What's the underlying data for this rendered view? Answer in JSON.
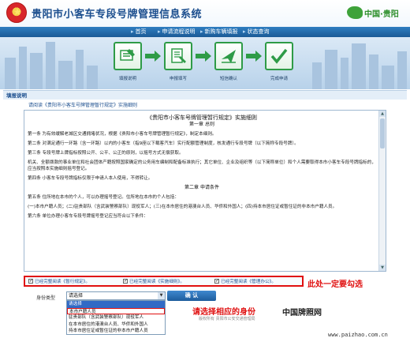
{
  "header": {
    "title": "贵阳市小客车专段号牌管理信息系统",
    "brand_text": "中国·贵阳"
  },
  "nav": {
    "items": [
      "首页",
      "申请流程说明",
      "新购车辆填报",
      "状态查询"
    ]
  },
  "steps": [
    {
      "label": "填报说明"
    },
    {
      "label": "申报填写"
    },
    {
      "label": "短信确认"
    },
    {
      "label": "完成申请"
    }
  ],
  "section": {
    "title": "填报说明",
    "instruction": "请阅读《贵阳市小客车号牌管理暂行规定》实施细则"
  },
  "document": {
    "title": "《贵阳市小客车号牌管理暂行规定》实施细则",
    "chapter1": "第一章  总则",
    "paragraphs": [
      "第一条  为有效缓解老城区交通拥堵状况，根据《贵阳市小客车号牌管理暂行规定》，制定本细则。",
      "第二条  对满足通行一环路（含一环路）以内的小客车（指9座以下载客汽车）实行配额管理制度，核发通行专段号牌（以下简称专段号牌）。",
      "第三条  专段号牌上牌指标按照公开、公平、公正的原则，以摇号方式无偿获取。",
      "机关、全额拨款的事业单位和社会团体产籍按照国家确定的公务用车编制和配备标准执行；其它单位、企业及组织等（以下简称单位）和个人需要取得本市小客车专段号牌指标的，应当按照本实施细则摇号登记。",
      "第四条  小客车专段号牌指标仅限于申请人本人使用，不得转让。"
    ],
    "chapter2": "第二章  申请条件",
    "paragraphs2": [
      "第五条  住所地在本市的个人，可以办理摇号登记。住所地在本市的个人包括：",
      "(一)本市户籍人员；(二)驻贵部队（含武装警察部队）现役军人；(三)在本市居住的港澳台人员、华侨和外国人；(四)持本市居住证或暂住证的非本市户籍人员。",
      "第六条  单位办理小客车专段号牌摇号登记应当符合以下条件："
    ]
  },
  "checks": [
    "已经完整阅读《暂行规定》。",
    "已经完整阅读《实施细则》。",
    "已经完整阅读《管理办公》。"
  ],
  "annotations": {
    "check_note": "此处一定要勾选",
    "select_note": "请选择相应的身份"
  },
  "identity": {
    "label": "身份类型",
    "selected": "请选择",
    "options": [
      "请选择",
      "本市户籍人员",
      "驻贵部队（含武装警察部队）现役军人",
      "在本市居住的港澳台人员、华侨和外国人",
      "持本市居住证或暂住证的非本市户籍人员"
    ]
  },
  "confirm_label": "确 认",
  "watermark": "中国牌照网",
  "footer_small": "版权所有 贵阳市公安交通管理局",
  "footer_url": "www.paizhao.com.cn",
  "colors": {
    "primary_blue": "#1b5a96",
    "step_green": "#2e9b47",
    "annotation_red": "#e01010",
    "selection_blue": "#316ac5"
  }
}
